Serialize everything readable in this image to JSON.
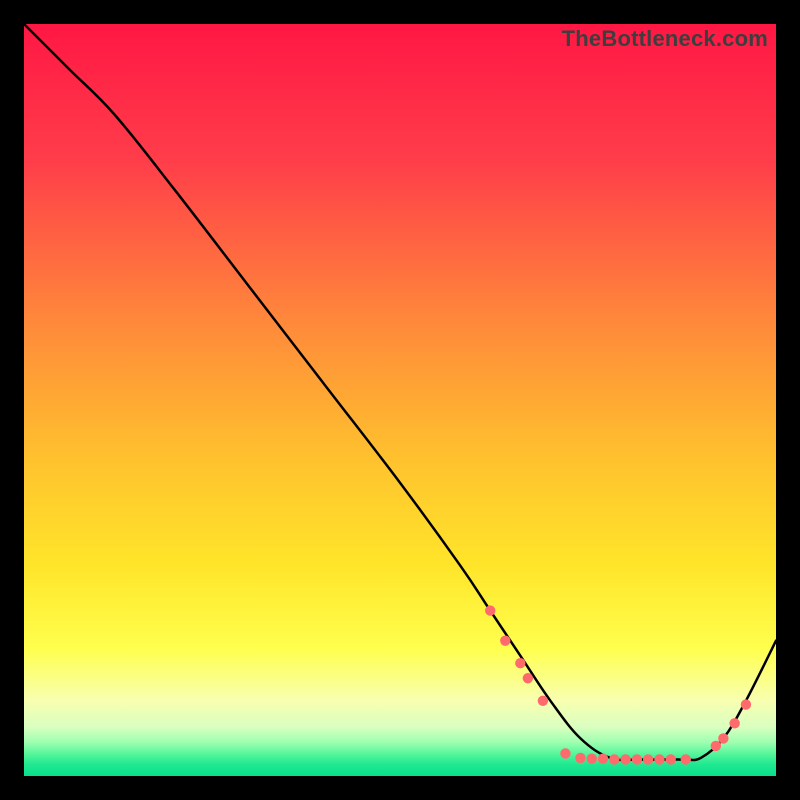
{
  "watermark": "TheBottleneck.com",
  "colors": {
    "black": "#000000",
    "curve": "#000000",
    "marker_fill": "#ff6a6c",
    "marker_stroke": "#ff6a6c",
    "gradient_stops": [
      {
        "offset": 0.0,
        "color": "#ff1744"
      },
      {
        "offset": 0.18,
        "color": "#ff3d4a"
      },
      {
        "offset": 0.4,
        "color": "#ff8a3a"
      },
      {
        "offset": 0.58,
        "color": "#ffc22e"
      },
      {
        "offset": 0.72,
        "color": "#ffe52a"
      },
      {
        "offset": 0.83,
        "color": "#ffff4d"
      },
      {
        "offset": 0.9,
        "color": "#f8ffb0"
      },
      {
        "offset": 0.935,
        "color": "#d9ffc0"
      },
      {
        "offset": 0.955,
        "color": "#9effb0"
      },
      {
        "offset": 0.972,
        "color": "#50f59a"
      },
      {
        "offset": 0.985,
        "color": "#1fe891"
      },
      {
        "offset": 1.0,
        "color": "#0adf8c"
      }
    ]
  },
  "chart_data": {
    "type": "line",
    "title": "",
    "xlabel": "",
    "ylabel": "",
    "xlim": [
      0,
      100
    ],
    "ylim": [
      0,
      100
    ],
    "series": [
      {
        "name": "curve",
        "x": [
          0,
          6,
          12,
          20,
          30,
          40,
          50,
          58,
          62,
          66,
          70,
          74,
          78,
          82,
          86,
          88,
          90,
          93,
          96,
          100
        ],
        "y": [
          100,
          94,
          88,
          78,
          65,
          52,
          39,
          28,
          22,
          16,
          10,
          5,
          2.4,
          2.2,
          2.2,
          2.2,
          2.4,
          5,
          10,
          18
        ]
      }
    ],
    "markers": [
      {
        "x": 62,
        "y": 22
      },
      {
        "x": 64,
        "y": 18
      },
      {
        "x": 66,
        "y": 15
      },
      {
        "x": 67,
        "y": 13
      },
      {
        "x": 69,
        "y": 10
      },
      {
        "x": 72,
        "y": 3.0
      },
      {
        "x": 74,
        "y": 2.4
      },
      {
        "x": 75.5,
        "y": 2.3
      },
      {
        "x": 77,
        "y": 2.3
      },
      {
        "x": 78.5,
        "y": 2.2
      },
      {
        "x": 80,
        "y": 2.2
      },
      {
        "x": 81.5,
        "y": 2.2
      },
      {
        "x": 83,
        "y": 2.2
      },
      {
        "x": 84.5,
        "y": 2.2
      },
      {
        "x": 86,
        "y": 2.2
      },
      {
        "x": 88,
        "y": 2.2
      },
      {
        "x": 92,
        "y": 4.0
      },
      {
        "x": 93,
        "y": 5.0
      },
      {
        "x": 94.5,
        "y": 7.0
      },
      {
        "x": 96,
        "y": 9.5
      }
    ],
    "annotations": []
  }
}
